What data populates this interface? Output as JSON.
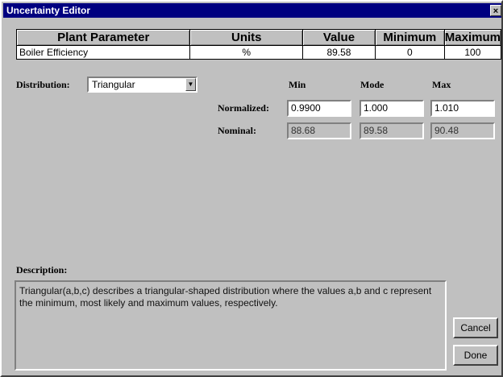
{
  "window": {
    "title": "Uncertainty Editor",
    "close_glyph": "×"
  },
  "table": {
    "headers": [
      "Plant Parameter",
      "Units",
      "Value",
      "Minimum",
      "Maximum"
    ],
    "row": {
      "parameter": "Boiler Efficiency",
      "units": "%",
      "value": "89.58",
      "minimum": "0",
      "maximum": "100"
    }
  },
  "distribution": {
    "label": "Distribution:",
    "selected": "Triangular",
    "arrow_glyph": "▼"
  },
  "columns": {
    "min": "Min",
    "mode": "Mode",
    "max": "Max"
  },
  "normalized": {
    "label": "Normalized:",
    "min": "0.9900",
    "mode": "1.000",
    "max": "1.010"
  },
  "nominal": {
    "label": "Nominal:",
    "min": "88.68",
    "mode": "89.58",
    "max": "90.48"
  },
  "description": {
    "label": "Description:",
    "text": "Triangular(a,b,c) describes a triangular-shaped distribution where the values a,b and c represent the minimum, most likely and maximum values, respectively."
  },
  "buttons": {
    "cancel": "Cancel",
    "done": "Done"
  }
}
